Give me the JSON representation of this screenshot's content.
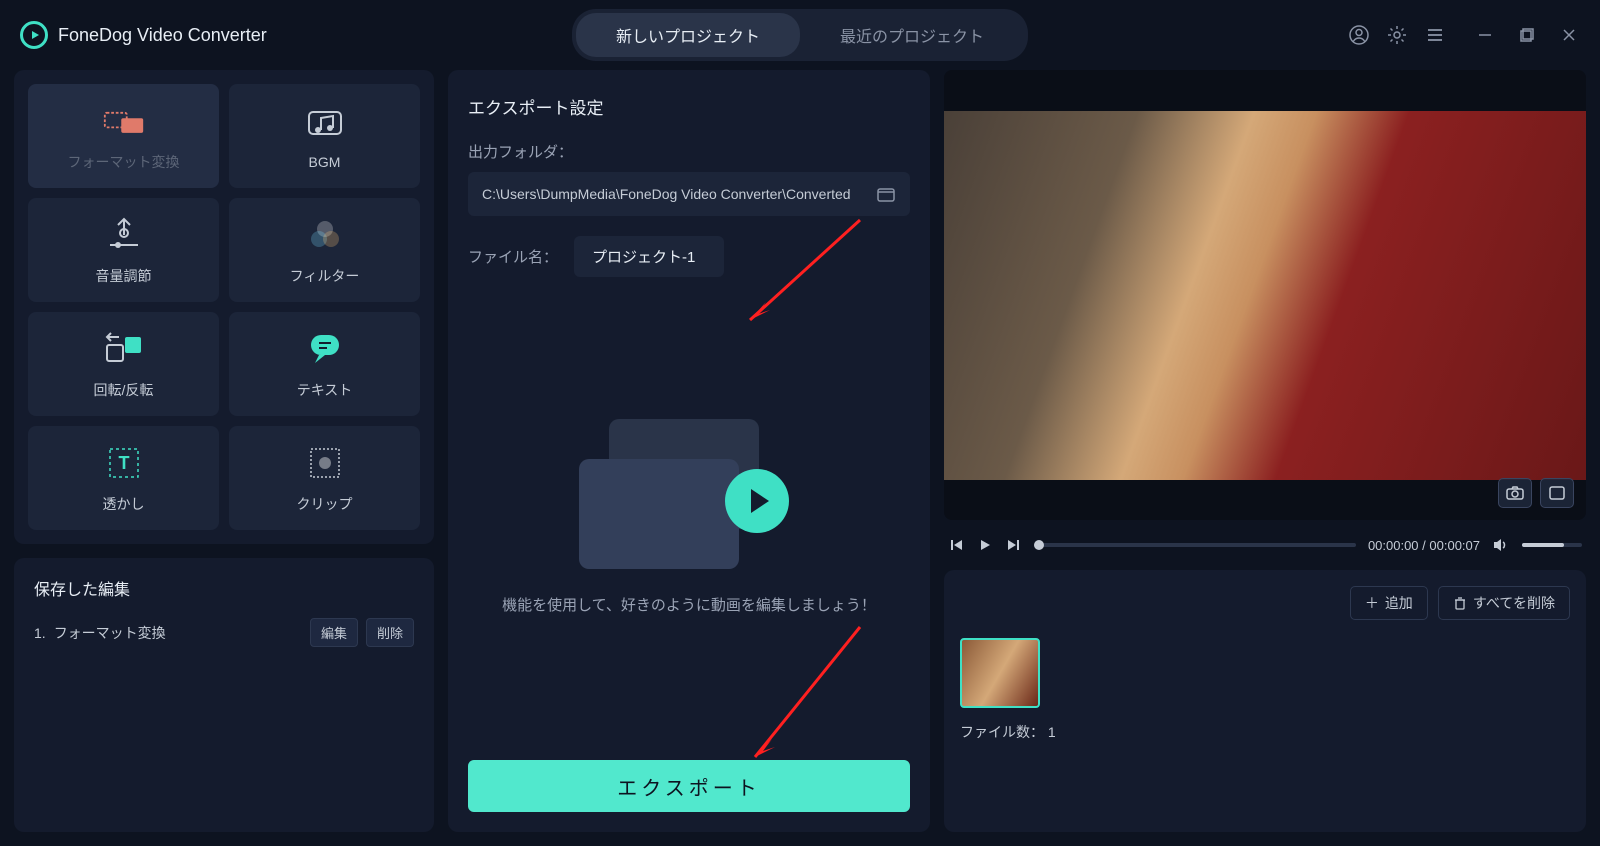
{
  "app": {
    "title": "FoneDog Video Converter"
  },
  "tabs": {
    "new_project": "新しいプロジェクト",
    "recent_projects": "最近のプロジェクト"
  },
  "tools": {
    "format": "フォーマット変換",
    "bgm": "BGM",
    "volume": "音量調節",
    "filter": "フィルター",
    "rotate": "回転/反転",
    "text": "テキスト",
    "watermark": "透かし",
    "clip": "クリップ"
  },
  "saved": {
    "title": "保存した編集",
    "item_index": "1.",
    "item_name": "フォーマット変換",
    "edit": "編集",
    "delete": "削除"
  },
  "export": {
    "section_title": "エクスポート設定",
    "output_folder_label": "出力フォルダ：",
    "output_folder_value": "C:\\Users\\DumpMedia\\FoneDog Video Converter\\Converted",
    "filename_label": "ファイル名：",
    "filename_value": "プロジェクト-1",
    "hint": "機能を使用して、好きのように動画を編集しましょう！",
    "button": "エクスポート"
  },
  "player": {
    "current_time": "00:00:00",
    "duration": "00:00:07"
  },
  "files": {
    "add": "追加",
    "delete_all": "すべてを削除",
    "count_label": "ファイル数：",
    "count_value": "1"
  }
}
